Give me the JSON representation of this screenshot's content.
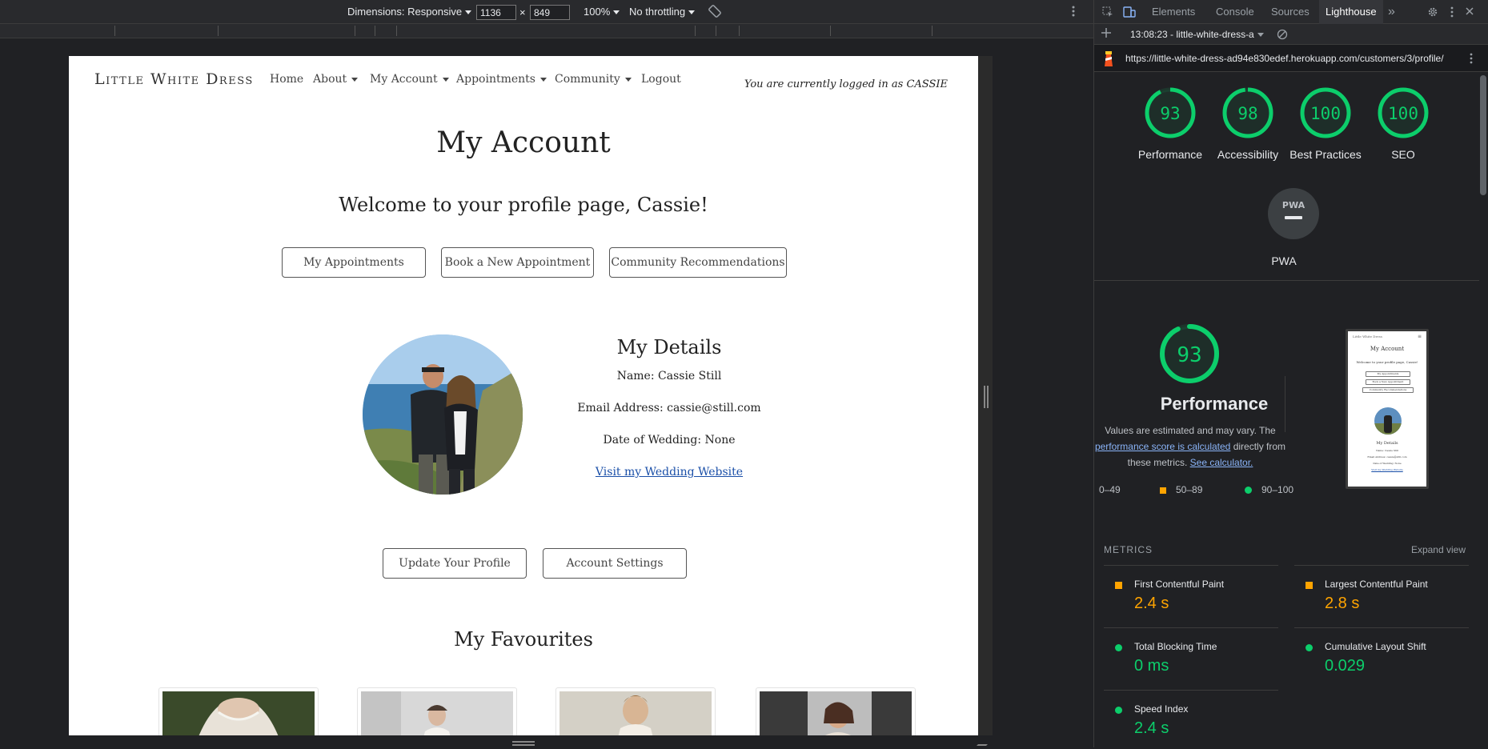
{
  "device_toolbar": {
    "dimensions_label": "Dimensions: Responsive",
    "width": "1136",
    "times": "×",
    "height": "849",
    "zoom": "100%",
    "throttling": "No throttling",
    "rotate_icon": "rotate-icon",
    "more_icon": "more-vertical-icon"
  },
  "site": {
    "brand": "Little White Dress",
    "nav": {
      "home": "Home",
      "about": "About",
      "my_account": "My Account",
      "appointments": "Appointments",
      "community": "Community",
      "logout": "Logout"
    },
    "logged_in": "You are currently logged in as CASSIE",
    "page_title": "My Account",
    "welcome": "Welcome to your profile page, Cassie!",
    "action_buttons": {
      "my_appointments": "My Appointments",
      "book_new": "Book a New Appointment",
      "community_recs": "Community Recommendations"
    },
    "details": {
      "title": "My Details",
      "name": "Name: Cassie Still",
      "email": "Email Address: cassie@still.com",
      "wedding_date": "Date of Wedding: None",
      "website_link": "Visit my Wedding Website"
    },
    "profile_buttons": {
      "update": "Update Your Profile",
      "settings": "Account Settings"
    },
    "favourites_title": "My Favourites"
  },
  "devtools": {
    "tabs": {
      "elements": "Elements",
      "console": "Console",
      "sources": "Sources",
      "lighthouse": "Lighthouse",
      "more": "»"
    },
    "report_label": "13:08:23 - little-white-dress-a",
    "url": "https://little-white-dress-ad94e830edef.herokuapp.com/customers/3/profile/",
    "scores": [
      {
        "key": "performance",
        "value": "93",
        "label": "Performance",
        "fraction": 0.93
      },
      {
        "key": "accessibility",
        "value": "98",
        "label": "Accessibility",
        "fraction": 0.98
      },
      {
        "key": "best_practices",
        "value": "100",
        "label": "Best Practices",
        "fraction": 1.0
      },
      {
        "key": "seo",
        "value": "100",
        "label": "SEO",
        "fraction": 1.0
      }
    ],
    "pwa": {
      "badge": "PWA",
      "label": "PWA"
    },
    "perf_summary": {
      "score": "93",
      "title": "Performance",
      "note_1": "Values are estimated and may vary. The",
      "note_link": "performance score is calculated",
      "note_2": "directly from",
      "note_3": "these metrics.",
      "calc_link": "See calculator."
    },
    "legend": {
      "low": "0–49",
      "mid": "50–89",
      "high": "90–100"
    },
    "metrics_heading": "METRICS",
    "expand_view": "Expand view",
    "metrics": {
      "fcp": {
        "name": "First Contentful Paint",
        "value": "2.4 s"
      },
      "lcp": {
        "name": "Largest Contentful Paint",
        "value": "2.8 s"
      },
      "tbt": {
        "name": "Total Blocking Time",
        "value": "0 ms"
      },
      "cls": {
        "name": "Cumulative Layout Shift",
        "value": "0.029"
      },
      "si": {
        "name": "Speed Index",
        "value": "2.4 s"
      }
    },
    "thumbnail": {
      "brand": "Little White Dress",
      "title": "My Account",
      "welcome": "Welcome to your profile page, Cassie!",
      "btn1": "My Appointments",
      "btn2": "Book a New Appointment",
      "btn3": "Community Recommendations",
      "details": "My Details",
      "name": "Name: Cassie Still",
      "email": "Email Address: cassie@still.com",
      "date": "Date of Wedding: None",
      "link": "Visit my Wedding Website"
    },
    "colors": {
      "pass": "#0cce6b",
      "average": "#ffa400",
      "fail": "#ff4e42"
    }
  }
}
